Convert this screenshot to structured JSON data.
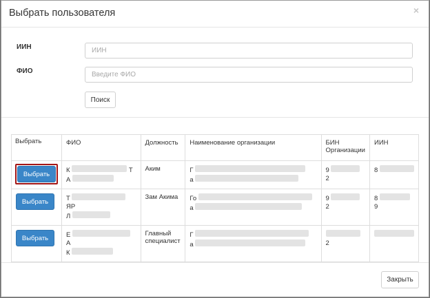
{
  "modal": {
    "title": "Выбрать пользователя",
    "close_glyph": "×"
  },
  "form": {
    "iin_label": "ИИН",
    "iin_placeholder": "ИИН",
    "fio_label": "ФИО",
    "fio_placeholder": "Введите ФИО",
    "search_label": "Поиск"
  },
  "table": {
    "headers": [
      "Выбрать",
      "ФИО",
      "Должность",
      "Наименование организации",
      "БИН Организации",
      "ИИН"
    ],
    "select_label": "Выбрать",
    "rows": [
      {
        "fio_start": "К",
        "fio_end": "Т",
        "fio_line2": "А",
        "position": "Аким",
        "org_start": "Г",
        "org_line2": "а",
        "bin_start": "9",
        "bin_end": "2",
        "iin_start": "8",
        "iin_end": ""
      },
      {
        "fio_start": "Т",
        "fio_end": "ЯР",
        "fio_line2": "Л",
        "position": "Зам Акима",
        "org_start": "Го",
        "org_line2": "а",
        "bin_start": "9",
        "bin_end": "2",
        "iin_start": "8",
        "iin_end": "9"
      },
      {
        "fio_start": "Е",
        "fio_end": "А",
        "fio_line2": "К",
        "position": "Главный специалист",
        "org_start": "Г",
        "org_line2": "а",
        "bin_start": "",
        "bin_end": "2",
        "iin_start": "",
        "iin_end": ""
      }
    ]
  },
  "footer": {
    "close_label": "Закрыть"
  }
}
